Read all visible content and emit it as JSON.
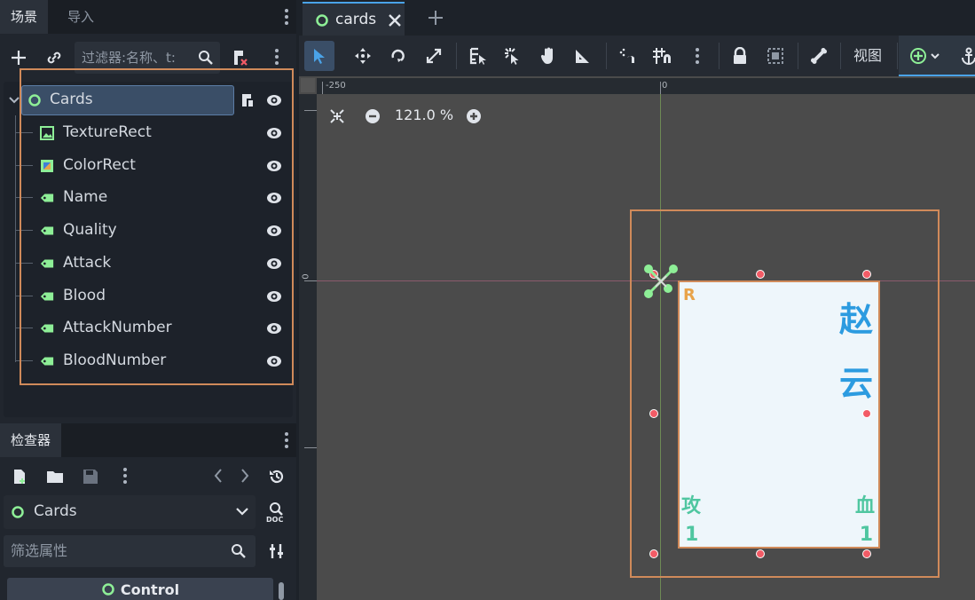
{
  "left_dock": {
    "tabs": [
      "场景",
      "导入"
    ],
    "filter_placeholder": "过滤器:名称、t:",
    "tree": {
      "root": "Cards",
      "children": [
        {
          "label": "TextureRect",
          "icon": "texture-rect-icon"
        },
        {
          "label": "ColorRect",
          "icon": "color-rect-icon"
        },
        {
          "label": "Name",
          "icon": "label-icon"
        },
        {
          "label": "Quality",
          "icon": "label-icon"
        },
        {
          "label": "Attack",
          "icon": "label-icon"
        },
        {
          "label": "Blood",
          "icon": "label-icon"
        },
        {
          "label": "AttackNumber",
          "icon": "label-icon"
        },
        {
          "label": "BloodNumber",
          "icon": "label-icon"
        }
      ]
    }
  },
  "inspector": {
    "tab": "检查器",
    "node_dropdown": "Cards",
    "filter_placeholder": "筛选属性",
    "section": "Control"
  },
  "editor": {
    "tab_label": "cards",
    "view_label": "视图",
    "zoom": "121.0 %",
    "ruler": {
      "h_labels": [
        "-250",
        "0"
      ],
      "v_label": "0"
    }
  },
  "card": {
    "name_chars": [
      "赵",
      "云"
    ],
    "quality": "R",
    "attack_label": "攻",
    "blood_label": "血",
    "attack_number": "1",
    "blood_number": "1"
  },
  "colors": {
    "accent": "#4aa3e8",
    "node_green": "#8eef97",
    "annotation": "#d08a5a",
    "card_name": "#2c9be0",
    "card_stat": "#4fc6a0"
  }
}
